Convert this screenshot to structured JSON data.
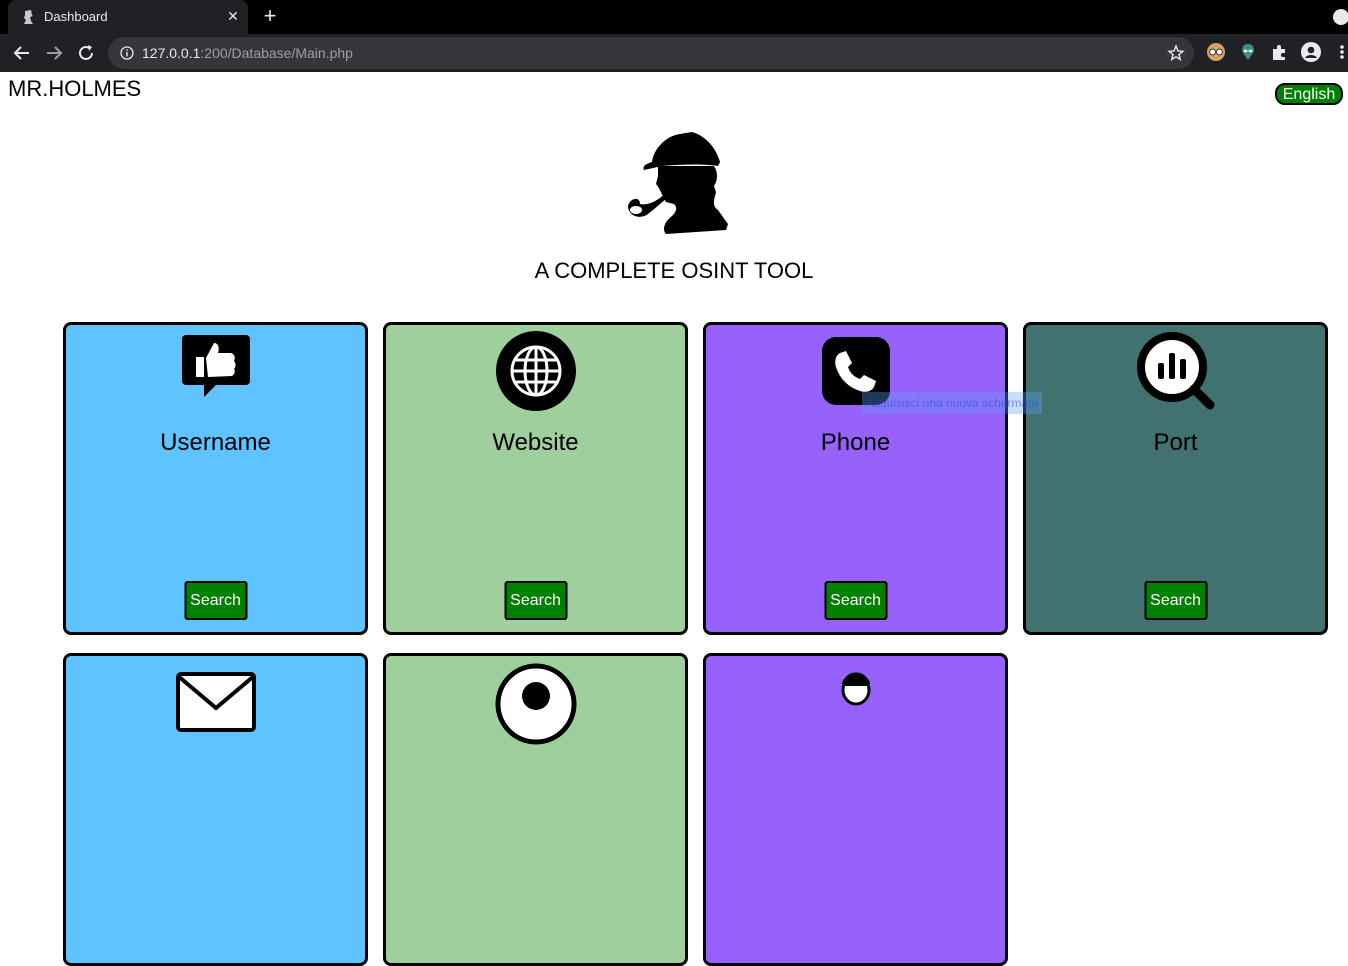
{
  "browser": {
    "tab_title": "Dashboard",
    "url_host": "127.0.0.1",
    "url_rest": ":200/Database/Main.php"
  },
  "page": {
    "brand": "MR.HOLMES",
    "language_button": "English",
    "tagline": "A COMPLETE OSINT TOOL",
    "tooltip_ghost": "Acquisisci una nuova schermata"
  },
  "cards": [
    {
      "title": "Username",
      "icon": "thumbs-up-speech-icon",
      "color": "#5ec3fe",
      "button": "Search"
    },
    {
      "title": "Website",
      "icon": "globe-icon",
      "color": "#a0cf9e",
      "button": "Search"
    },
    {
      "title": "Phone",
      "icon": "phone-icon",
      "color": "#9762fb",
      "button": "Search"
    },
    {
      "title": "Port",
      "icon": "magnifier-chart-icon",
      "color": "#417270",
      "button": "Search"
    },
    {
      "title": "",
      "icon": "envelope-icon",
      "color": "#5ec3fe",
      "button": ""
    },
    {
      "title": "",
      "icon": "person-pin-icon",
      "color": "#a0cf9e",
      "button": ""
    },
    {
      "title": "",
      "icon": "person-icon",
      "color": "#9762fb",
      "button": ""
    }
  ]
}
